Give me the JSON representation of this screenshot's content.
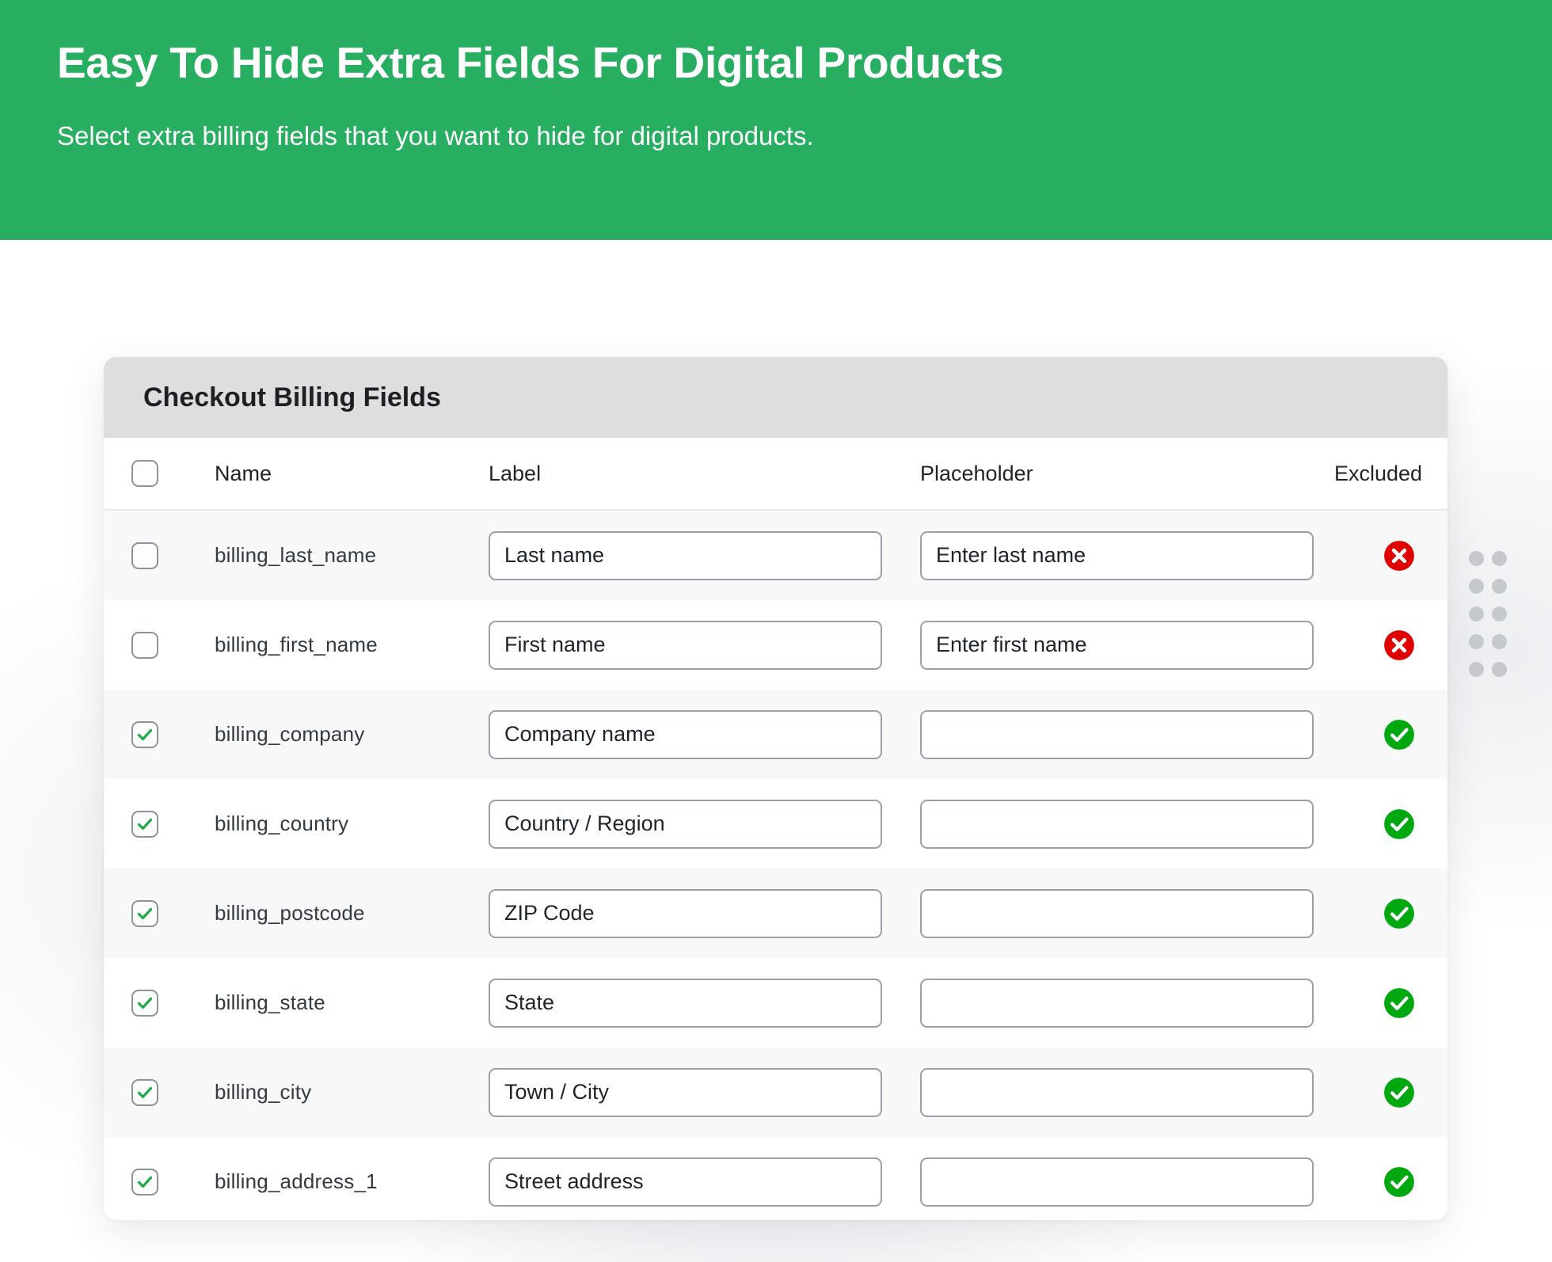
{
  "hero": {
    "title": "Easy To Hide Extra Fields For Digital Products",
    "subtitle": "Select extra billing fields that you want to hide for digital products.",
    "background_color": "#27ae60",
    "text_color": "#ffffff"
  },
  "card": {
    "header_title": "Checkout Billing Fields",
    "header_background": "#dededf"
  },
  "table": {
    "columns": [
      {
        "key": "select_all",
        "label": ""
      },
      {
        "key": "name",
        "label": "Name"
      },
      {
        "key": "label",
        "label": "Label"
      },
      {
        "key": "placeholder",
        "label": "Placeholder"
      },
      {
        "key": "excluded",
        "label": "Excluded"
      }
    ],
    "select_all_checked": false,
    "rows": [
      {
        "checked": false,
        "name": "billing_last_name",
        "label_value": "Last name",
        "placeholder_value": "Enter last name",
        "excluded": false,
        "excluded_icon": "red-x-circle-icon"
      },
      {
        "checked": false,
        "name": "billing_first_name",
        "label_value": "First name",
        "placeholder_value": "Enter first name",
        "excluded": false,
        "excluded_icon": "red-x-circle-icon"
      },
      {
        "checked": true,
        "name": "billing_company",
        "label_value": "Company name",
        "placeholder_value": "",
        "excluded": true,
        "excluded_icon": "green-check-circle-icon"
      },
      {
        "checked": true,
        "name": "billing_country",
        "label_value": "Country / Region",
        "placeholder_value": "",
        "excluded": true,
        "excluded_icon": "green-check-circle-icon"
      },
      {
        "checked": true,
        "name": "billing_postcode",
        "label_value": "ZIP Code",
        "placeholder_value": "",
        "excluded": true,
        "excluded_icon": "green-check-circle-icon"
      },
      {
        "checked": true,
        "name": "billing_state",
        "label_value": "State",
        "placeholder_value": "",
        "excluded": true,
        "excluded_icon": "green-check-circle-icon"
      },
      {
        "checked": true,
        "name": "billing_city",
        "label_value": "Town / City",
        "placeholder_value": "",
        "excluded": true,
        "excluded_icon": "green-check-circle-icon"
      },
      {
        "checked": true,
        "name": "billing_address_1",
        "label_value": "Street address",
        "placeholder_value": "",
        "excluded": true,
        "excluded_icon": "green-check-circle-icon"
      }
    ]
  },
  "decoration": {
    "dot_grid_rows": 5,
    "dot_grid_cols": 2,
    "dot_color": "#c5c8cd"
  },
  "colors": {
    "accent_green": "#27ae60",
    "check_green": "#00a80f",
    "error_red": "#e00000",
    "row_alt": "#f8f8f9"
  }
}
